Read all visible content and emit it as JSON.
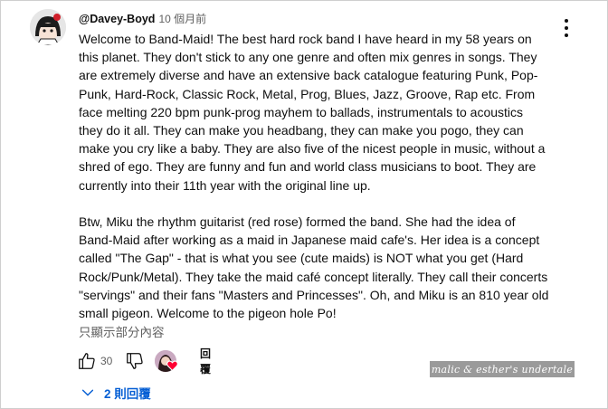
{
  "comment": {
    "author": "@Davey-Boyd",
    "time": "10 個月前",
    "text": "Welcome to Band-Maid! The best hard rock band I have heard in my 58 years on this planet. They don't stick to any one genre and often mix genres in songs. They are extremely diverse and have an extensive back catalogue featuring Punk, Pop-Punk, Hard-Rock, Classic Rock, Metal, Prog, Blues, Jazz, Groove, Rap etc. From face melting 220 bpm punk-prog mayhem to ballads, instrumentals to acoustics they do it all. They can make you headbang, they can make you pogo, they can make you cry like a baby. They are also five of the nicest people in music, without a shred of ego. They are funny and fun and world class musicians to boot. They are currently into their 11th year with the original line up.\n\nBtw, Miku the rhythm guitarist (red rose) formed the band. She had the idea of Band-Maid after working as a maid in Japanese maid cafe's. Her idea is a concept called \"The Gap\" - that is what you see (cute maids) is NOT what you get (Hard Rock/Punk/Metal). They take the maid café concept literally. They call their concerts \"servings\" and their fans \"Masters and Princesses\". Oh, and Miku is an 810 year old small pigeon. Welcome to the pigeon hole Po!",
    "show_less": "只顯示部分內容",
    "like_count": "30",
    "reply_label": "回覆",
    "replies_label": "2 則回覆"
  },
  "watermark": "malic & esther's undertale",
  "colors": {
    "link_blue": "#065fd4",
    "secondary_text": "#606060",
    "heart_red": "#ff0033"
  },
  "icons": [
    "avatar",
    "more-vert-icon",
    "thumb-up-icon",
    "thumb-down-icon",
    "creator-heart-icon",
    "chevron-down-icon"
  ]
}
